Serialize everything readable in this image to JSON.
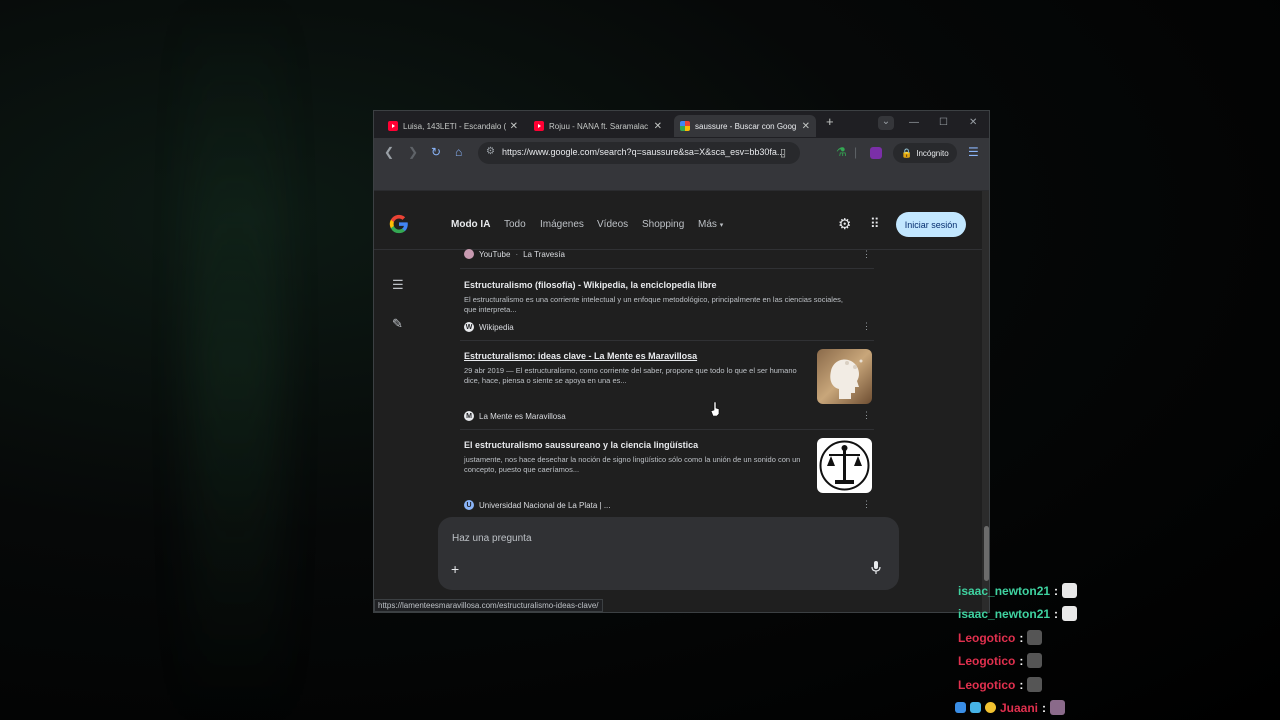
{
  "tabs": [
    {
      "title": "Luisa, 143LETI - Escandalo (V",
      "active": false,
      "favicon": "youtube-icon"
    },
    {
      "title": "Rojuu - NANA ft. Saramalac",
      "active": false,
      "favicon": "youtube-icon"
    },
    {
      "title": "saussure - Buscar con Goog",
      "active": true,
      "favicon": "google-icon"
    }
  ],
  "address_bar": {
    "url": "https://www.google.com/search?q=saussure&sa=X&sca_esv=bb30fa..."
  },
  "incognito_label": "Incógnito",
  "google_nav": {
    "tabs": [
      "Modo IA",
      "Todo",
      "Imágenes",
      "Vídeos",
      "Shopping",
      "Más"
    ],
    "signin_label": "Iniciar sesión"
  },
  "results": {
    "top_source": {
      "site": "YouTube",
      "channel": "La Travesía"
    },
    "items": [
      {
        "title": "Estructuralismo (filosofía) - Wikipedia, la enciclopedia libre",
        "snippet": "El estructuralismo es una corriente intelectual y un enfoque metodológico, principalmente en las ciencias sociales, que interpreta...",
        "source": "Wikipedia",
        "source_icon": "W"
      },
      {
        "title": "Estructuralismo: ideas clave - La Mente es Maravillosa",
        "snippet": "29 abr 2019 — El estructuralismo, como corriente del saber, propone que todo lo que el ser humano dice, hace, piensa o siente se apoya en una es...",
        "source": "La Mente es Maravillosa",
        "source_icon": "M"
      },
      {
        "title": "El estructuralismo saussureano y la ciencia lingüística",
        "snippet": "justamente, nos hace desechar la noción de signo lingüístico sólo como la unión de un sonido con un concepto, puesto que caeríamos...",
        "source": "Universidad Nacional de La Plata | ...",
        "source_icon": "U"
      }
    ]
  },
  "ask_box": {
    "placeholder": "Haz una pregunta"
  },
  "status_url": "https://lamenteesmaravillosa.com/estructuralismo-ideas-clave/",
  "chat": [
    {
      "user": "isaac_newton21",
      "sep": ":",
      "color": "#3fd2a0"
    },
    {
      "user": "isaac_newton21",
      "sep": ":",
      "color": "#3fd2a0"
    },
    {
      "user": "Leogotico",
      "sep": ":",
      "color": "#e0304e"
    },
    {
      "user": "Leogotico",
      "sep": ":",
      "color": "#e0304e"
    },
    {
      "user": "Leogotico",
      "sep": ":",
      "color": "#e0304e"
    },
    {
      "user": "Juaani",
      "sep": ":",
      "color": "#e0304e"
    }
  ]
}
